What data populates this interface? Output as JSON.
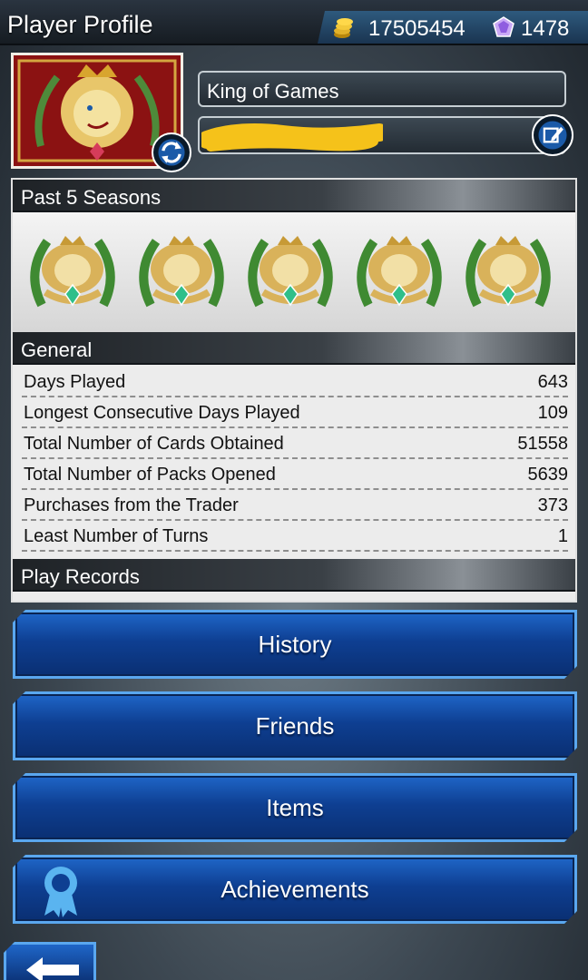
{
  "header": {
    "title": "Player Profile",
    "gold": "17505454",
    "gems": "1478",
    "gold_icon": "gold-coins-icon",
    "gem_icon": "gem-icon"
  },
  "profile": {
    "name": "King of Games",
    "avatar_icon": "king-of-games-lion-icon"
  },
  "seasons": {
    "header": "Past 5 Seasons",
    "crests": [
      "king-of-games-crest",
      "king-of-games-crest",
      "king-of-games-crest",
      "king-of-games-crest",
      "king-of-games-crest"
    ]
  },
  "general": {
    "header": "General",
    "rows": [
      {
        "label": "Days Played",
        "value": "643"
      },
      {
        "label": "Longest Consecutive Days Played",
        "value": "109"
      },
      {
        "label": "Total Number of Cards Obtained",
        "value": "51558"
      },
      {
        "label": "Total Number of Packs Opened",
        "value": "5639"
      },
      {
        "label": "Purchases from the Trader",
        "value": "373"
      },
      {
        "label": "Least Number of Turns",
        "value": "1"
      }
    ]
  },
  "play_records": {
    "header": "Play Records"
  },
  "menu": {
    "history": "History",
    "friends": "Friends",
    "items": "Items",
    "achievements": "Achievements"
  },
  "colors": {
    "button_blue": "#0e3f92",
    "button_border": "#5aa7ef",
    "panel_bg": "#ececec",
    "highlighter": "#f5c21a"
  }
}
